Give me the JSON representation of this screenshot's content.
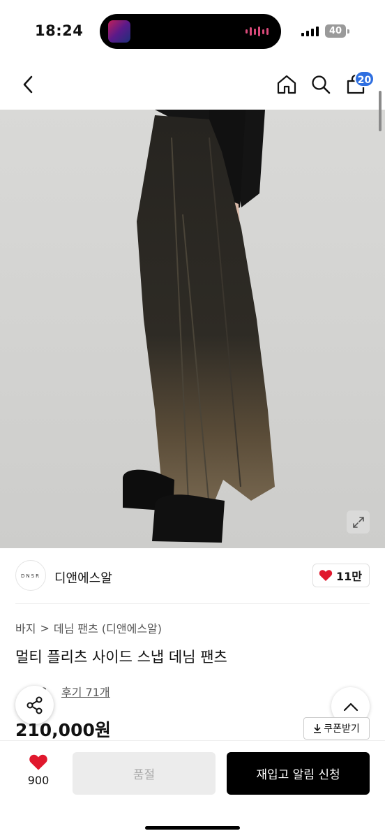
{
  "status_bar": {
    "time": "18:24",
    "battery": "40"
  },
  "nav": {
    "cart_count": "20"
  },
  "brand": {
    "logo_text": "DNSR",
    "name": "디앤에스알",
    "likes": "11만"
  },
  "breadcrumb": {
    "category": "바지",
    "separator": ">",
    "subcategory": "데님 팬츠 (디앤에스알)"
  },
  "product": {
    "title": "멀티 플리츠 사이드 스냅 데님 팬츠",
    "rating": "4.8",
    "reviews": "후기 71개",
    "price": "210,000원",
    "coupon_label": "쿠폰받기"
  },
  "bottom_bar": {
    "wish_count": "900",
    "soldout_label": "품절",
    "restock_label": "재입고 알림 신청"
  },
  "colors": {
    "accent": "#2f6fe0",
    "heart": "#e0182d",
    "primary_button": "#000000"
  }
}
